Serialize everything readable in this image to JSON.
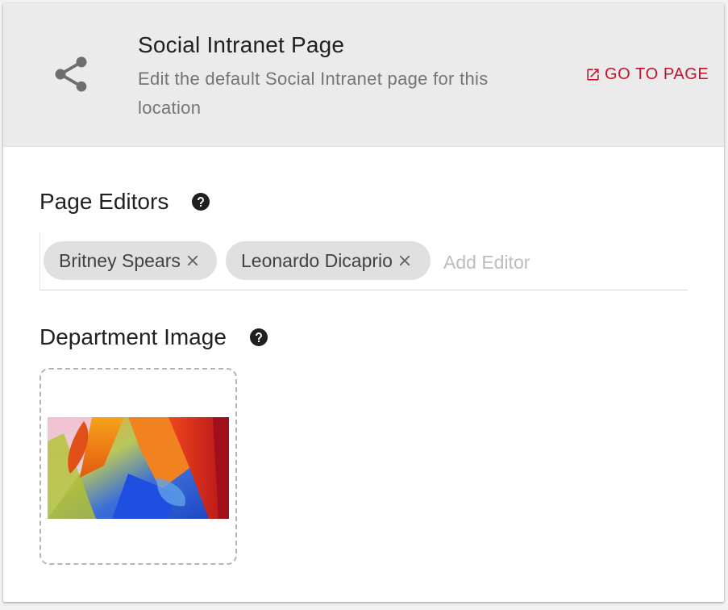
{
  "header": {
    "icon": "share-icon",
    "title": "Social Intranet Page",
    "description": "Edit the default Social Intranet page for this location",
    "goto_label": "GO TO PAGE",
    "goto_icon": "external-link-icon",
    "accent_color": "#c8102e"
  },
  "editors": {
    "label": "Page Editors",
    "help_icon": "help-icon",
    "chips": [
      {
        "label": "Britney Spears",
        "remove_icon": "close-icon"
      },
      {
        "label": "Leonardo Dicaprio",
        "remove_icon": "close-icon"
      }
    ],
    "input_placeholder": "Add Editor"
  },
  "image": {
    "label": "Department Image",
    "help_icon": "help-icon",
    "thumbnail": "colorful-flower-macro-image"
  }
}
